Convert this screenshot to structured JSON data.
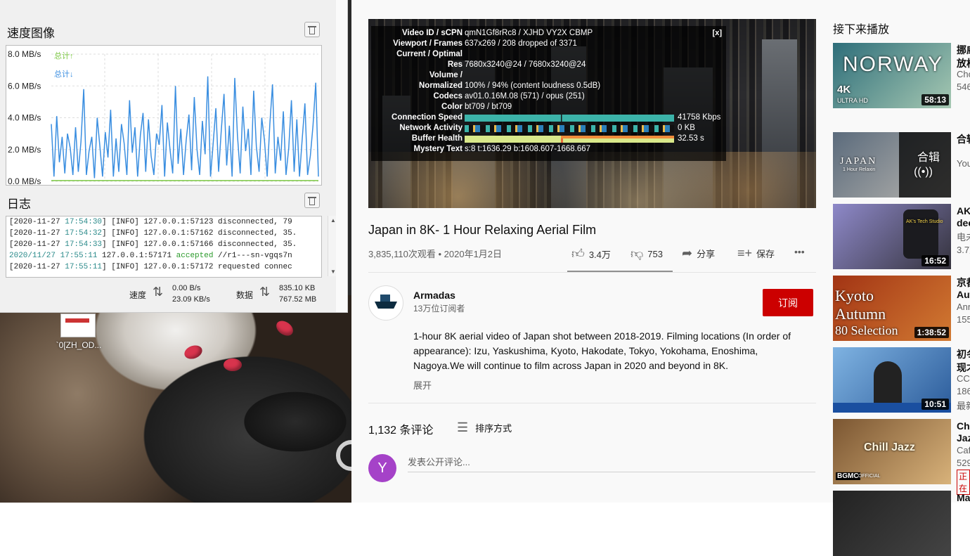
{
  "speed_panel": {
    "chart_title": "速度图像",
    "log_title": "日志",
    "legend": {
      "up": "总计↑",
      "down": "总计↓"
    },
    "speed_label": "速度",
    "speed_up": "0.00 B/s",
    "speed_down": "23.09 KB/s",
    "data_label": "数据",
    "data_up": "835.10 KB",
    "data_down": "767.52 MB",
    "log_lines": [
      {
        "date": "[2020-11-27 ",
        "time": "17:54:30",
        "rest": "] [INFO] 127.0.0.1:57123 disconnected, 79",
        "accepted": ""
      },
      {
        "date": "[2020-11-27 ",
        "time": "17:54:32",
        "rest": "] [INFO] 127.0.0.1:57162 disconnected, 35.",
        "accepted": ""
      },
      {
        "date": "[2020-11-27 ",
        "time": "17:54:33",
        "rest": "] [INFO] 127.0.0.1:57166 disconnected, 35.",
        "accepted": ""
      },
      {
        "date": "2020/11/27 17:55:11",
        "time": "",
        "rest": " 127.0.0.1:57171 ",
        "accepted": "accepted",
        "tail": " //r1---sn-vgqs7n"
      },
      {
        "date": "[2020-11-27 ",
        "time": "17:55:11",
        "rest": "] [INFO] 127.0.0.1:57172 requested connec",
        "accepted": ""
      }
    ]
  },
  "chart_data": {
    "type": "line",
    "ylabel_ticks": [
      "8.0 MB/s",
      "6.0 MB/s",
      "4.0 MB/s",
      "2.0 MB/s",
      "0.0 MB/s"
    ],
    "ylim": [
      0,
      8
    ],
    "grid": true,
    "legend_position": "top-left",
    "series": [
      {
        "name": "总计↑",
        "color": "#7cc843",
        "values": [
          0.05,
          0.05,
          0.05,
          0.05,
          0.05,
          0.05,
          0.05,
          0.05,
          0.05,
          0.05,
          0.05,
          0.05,
          0.05,
          0.05,
          0.05,
          0.05,
          0.05,
          0.05,
          0.05,
          0.05,
          0.05,
          0.05,
          0.05,
          0.05,
          0.05,
          0.05,
          0.05,
          0.05,
          0.05,
          0.05,
          0.05,
          0.05,
          0.05,
          0.05,
          0.05,
          0.05,
          0.05,
          0.05,
          0.05,
          0.05,
          0.05,
          0.05,
          0.05,
          0.05,
          0.05,
          0.05,
          0.05,
          0.05,
          0.05,
          0.05,
          0.05,
          0.05,
          0.05,
          0.05,
          0.05,
          0.05,
          0.05,
          0.05,
          0.05,
          0.05,
          0.05,
          0.05,
          0.05,
          0.05,
          0.05,
          0.05,
          0.05,
          0.05,
          0.05,
          0.05,
          0.05,
          0.05,
          0.05,
          0.05,
          0.05,
          0.05,
          0.05,
          0.05,
          0.05,
          0.05,
          0.05,
          0.05,
          0.05,
          0.05,
          0.05,
          0.05,
          0.05,
          0.05,
          0.05,
          0.05,
          0.05,
          0.05,
          0.05,
          0.05,
          0.05,
          0.05,
          0.05,
          0.05,
          0.05,
          0.05
        ]
      },
      {
        "name": "总计↓",
        "color": "#3a8ee0",
        "values": [
          3.6,
          0.3,
          4.1,
          1.2,
          2.8,
          0.5,
          3.0,
          2.1,
          0.4,
          3.4,
          0.6,
          2.5,
          5.8,
          0.4,
          1.9,
          2.8,
          0.2,
          4.0,
          2.2,
          0.3,
          3.1,
          1.5,
          4.5,
          0.3,
          2.7,
          0.6,
          3.6,
          2.4,
          0.4,
          5.1,
          1.8,
          3.4,
          0.3,
          2.9,
          4.3,
          0.6,
          3.9,
          1.6,
          0.4,
          3.0,
          2.3,
          4.8,
          0.3,
          3.7,
          2.0,
          0.5,
          6.0,
          1.1,
          3.3,
          0.4,
          2.6,
          4.2,
          0.7,
          5.3,
          2.0,
          0.4,
          3.8,
          1.7,
          6.6,
          0.3,
          2.4,
          4.6,
          0.6,
          3.2,
          5.5,
          1.0,
          3.5,
          0.3,
          6.5,
          2.9,
          0.5,
          4.7,
          1.9,
          3.3,
          0.4,
          5.7,
          2.2,
          0.6,
          4.0,
          2.6,
          0.3,
          3.6,
          6.1,
          0.5,
          2.8,
          1.3,
          4.4,
          0.4,
          2.1,
          5.1,
          0.6,
          3.9,
          0.3,
          2.7,
          4.9,
          0.4,
          1.6,
          3.5,
          6.2,
          0.3
        ]
      }
    ]
  },
  "desktop": {
    "icon_label": "`0[ZH_OD..."
  },
  "stats_overlay": {
    "close": "[x]",
    "rows": [
      {
        "k": "Video ID / sCPN",
        "v": "qmN1Gf8rRc8 / XJHD VY2X CBMP"
      },
      {
        "k": "Viewport / Frames",
        "v": "637x269 / 208 dropped of 3371"
      },
      {
        "k": "Current / Optimal",
        "v": ""
      },
      {
        "k": "Res",
        "v": "7680x3240@24 / 7680x3240@24"
      },
      {
        "k": "Volume /",
        "v": ""
      },
      {
        "k": "Normalized",
        "v": "100% / 94% (content loudness 0.5dB)"
      },
      {
        "k": "Codecs",
        "v": "av01.0.16M.08 (571) / opus (251)"
      },
      {
        "k": "Color",
        "v": "bt709 / bt709"
      },
      {
        "k": "Connection Speed",
        "v": "41758 Kbps"
      },
      {
        "k": "Network Activity",
        "v": "0 KB"
      },
      {
        "k": "Buffer Health",
        "v": "32.53 s"
      },
      {
        "k": "Mystery Text",
        "v": "s:8 t:1636.29 b:1608.607-1668.667"
      }
    ]
  },
  "video": {
    "title": "Japan in 8K- 1 Hour Relaxing Aerial Film",
    "meta": "3,835,110次观看 • 2020年1月2日",
    "likes": "3.4万",
    "dislikes": "753",
    "share": "分享",
    "save": "保存",
    "more_icon": "•••"
  },
  "channel": {
    "name": "Armadas",
    "subs": "13万位订阅者",
    "subscribe": "订阅",
    "description": "1-hour 8K aerial video of Japan shot between 2018-2019. Filming locations (In order of appearance): Izu, Yaskushima, Kyoto, Hakodate, Tokyo, Yokohama, Enoshima, Nagoya.We will continue to film across Japan in 2020 and beyond in 8K.",
    "show_more": "展开"
  },
  "comments": {
    "count": "1,132 条评论",
    "sort": "排序方式",
    "avatar_letter": "Y",
    "placeholder": "发表公开评论..."
  },
  "up_next": {
    "title": "接下来播放",
    "items": [
      {
        "duration": "58:13",
        "l1": "挪威",
        "l2": "放松",
        "l3": "Cho",
        "l4": "546",
        "overlay": "NORWAY",
        "overlay2": "4K",
        "overlay3": "ULTRA HD",
        "c1": "#2e6e7a",
        "c2": "#a6c8b2"
      },
      {
        "duration": "",
        "l1": "合辑",
        "l2": "",
        "l3": "You",
        "l4": "",
        "overlay": "合辑",
        "overlay2": "JAPAN",
        "overlay3": "1 Hour Relaxin",
        "c1": "#5b6b7c",
        "c2": "#b9b6b0"
      },
      {
        "duration": "16:52",
        "l1": "AK",
        "l2": "dec",
        "l3": "电未",
        "l4": "3.7万",
        "overlay": "AK's Tech Studio",
        "overlay2": "",
        "overlay3": "",
        "c1": "#8e89c9",
        "c2": "#34323c"
      },
      {
        "duration": "1:38:52",
        "l1": "京都",
        "l2": "Aut",
        "l3": "Ann",
        "l4": "155",
        "overlay": "Kyoto",
        "overlay2": "Autumn",
        "overlay3": "80 Selection",
        "c1": "#a23414",
        "c2": "#d27a32"
      },
      {
        "duration": "10:51",
        "l1": "初冬",
        "l2": "现才",
        "l3": "CCT",
        "l4": "186",
        "l5": "最新",
        "overlay": "",
        "overlay2": "",
        "overlay3": "",
        "c1": "#7fb3e2",
        "c2": "#2b5b9a"
      },
      {
        "duration": "",
        "l1": "Chi",
        "l2": "Jaz",
        "l3": "Caf",
        "l4": "529",
        "badge": "正在",
        "overlay": "Chill Jazz",
        "overlay2": "BGMC",
        "overlay3": "OFFICIAL",
        "c1": "#7b5632",
        "c2": "#d8b27a"
      },
      {
        "duration": "",
        "l1": "Ma",
        "l2": "",
        "l3": "",
        "l4": "",
        "overlay": "",
        "overlay2": "",
        "overlay3": "",
        "c1": "#222",
        "c2": "#444"
      }
    ]
  }
}
